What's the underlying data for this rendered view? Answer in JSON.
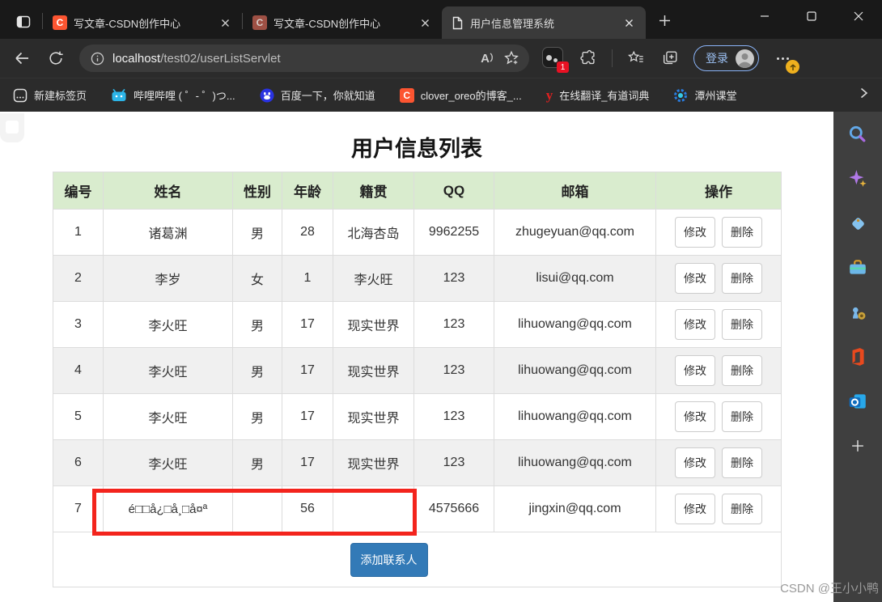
{
  "browser": {
    "tabs": [
      {
        "title": "写文章-CSDN创作中心"
      },
      {
        "title": "写文章-CSDN创作中心"
      },
      {
        "title": "用户信息管理系统"
      }
    ],
    "url": {
      "host": "localhost",
      "path": "/test02/userListServlet"
    },
    "login_label": "登录",
    "extension_badge_count": "1",
    "bookmarks": [
      "新建标签页",
      "哔哩哔哩 ( ゜- ゜)つ...",
      "百度一下，你就知道",
      "clover_oreo的博客_...",
      "在线翻译_有道词典",
      "潭州课堂"
    ]
  },
  "icons": {
    "csdn_letter": "C",
    "youdao_letter": "y",
    "read_aloud_letter": "A"
  },
  "page": {
    "title": "用户信息列表",
    "watermark": "CSDN @王小小鸭",
    "add_contact_label": "添加联系人",
    "colors": {
      "header_bg": "#d9ecce",
      "primary_button": "#337ab7",
      "annotation_red": "#f3241d"
    },
    "table": {
      "headers": [
        "编号",
        "姓名",
        "性别",
        "年龄",
        "籍贯",
        "QQ",
        "邮箱",
        "操作"
      ],
      "edit_label": "修改",
      "delete_label": "删除",
      "rows": [
        {
          "id": "1",
          "name": "诸葛渊",
          "gender": "男",
          "age": "28",
          "hometown": "北海杏岛",
          "qq": "9962255",
          "email": "zhugeyuan@qq.com"
        },
        {
          "id": "2",
          "name": "李岁",
          "gender": "女",
          "age": "1",
          "hometown": "李火旺",
          "qq": "123",
          "email": "lisui@qq.com"
        },
        {
          "id": "3",
          "name": "李火旺",
          "gender": "男",
          "age": "17",
          "hometown": "现实世界",
          "qq": "123",
          "email": "lihuowang@qq.com"
        },
        {
          "id": "4",
          "name": "李火旺",
          "gender": "男",
          "age": "17",
          "hometown": "现实世界",
          "qq": "123",
          "email": "lihuowang@qq.com"
        },
        {
          "id": "5",
          "name": "李火旺",
          "gender": "男",
          "age": "17",
          "hometown": "现实世界",
          "qq": "123",
          "email": "lihuowang@qq.com"
        },
        {
          "id": "6",
          "name": "李火旺",
          "gender": "男",
          "age": "17",
          "hometown": "现实世界",
          "qq": "123",
          "email": "lihuowang@qq.com"
        },
        {
          "id": "7",
          "name": "é□□å¿□å¸□å¤ª",
          "gender": "",
          "age": "56",
          "hometown": "",
          "qq": "4575666",
          "email": "jingxin@qq.com"
        }
      ]
    }
  }
}
